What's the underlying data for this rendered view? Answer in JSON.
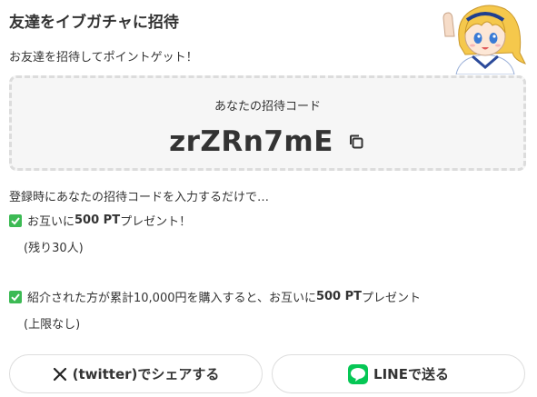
{
  "header": {
    "title": "友達をイブガチャに招待",
    "subtitle": "お友達を招待してポイントゲット！"
  },
  "code_box": {
    "label": "あなたの招待コード",
    "code": "zrZRn7mE"
  },
  "intro": "登録時にあなたの招待コードを入力するだけで…",
  "benefits": [
    {
      "prefix": "お互いに",
      "points": "500 PT",
      "suffix": "プレゼント！",
      "note": "(残り30人)"
    },
    {
      "prefix": "紹介された方が累計10,000円を購入すると、お互いに",
      "points": "500 PT",
      "suffix": "プレゼント",
      "note": "(上限なし)"
    }
  ],
  "share": {
    "twitter_label": "(twitter)でシェアする",
    "line_label": "LINEで送る"
  },
  "colors": {
    "check": "#3cba54",
    "line_green": "#06c755",
    "box_bg": "#f6f6f6",
    "box_border": "#dcdcdc"
  }
}
